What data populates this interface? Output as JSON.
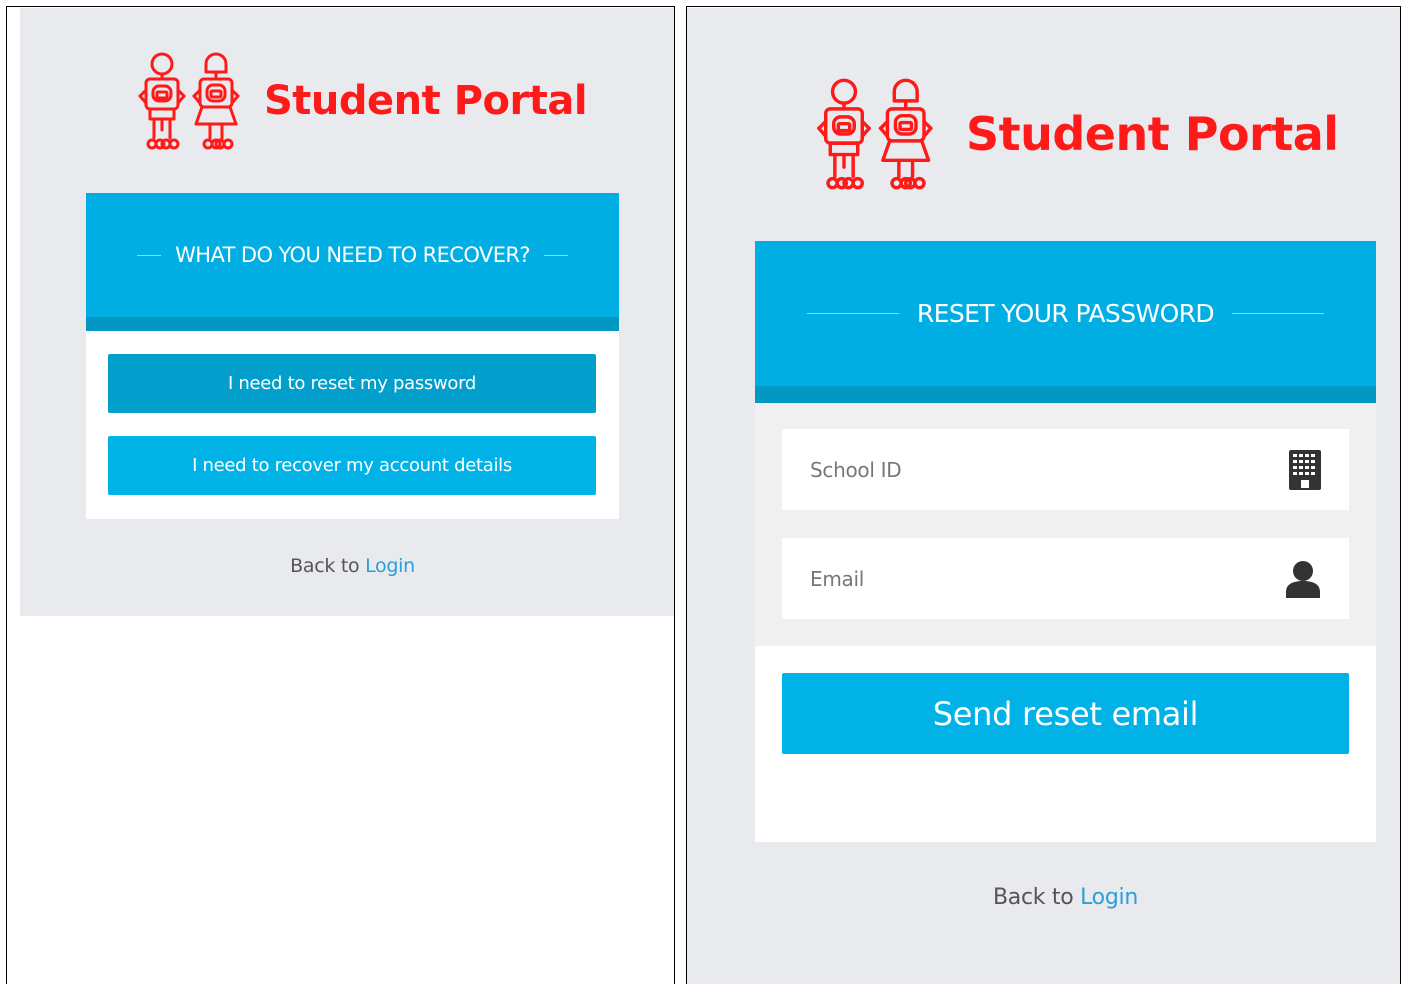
{
  "brand": {
    "title": "Student Portal",
    "logo_color": "#ff1a1a"
  },
  "colors": {
    "accent": "#01aee3",
    "accent_dark": "#0397c4",
    "panel_bg": "#e9eaee",
    "link": "#2b9fd6"
  },
  "recover_panel": {
    "heading": "WHAT DO YOU NEED TO RECOVER?",
    "buttons": {
      "reset_password": "I need to reset my password",
      "recover_account": "I need to recover my account details"
    },
    "back_text": "Back to",
    "back_link": "Login"
  },
  "reset_panel": {
    "heading": "RESET YOUR PASSWORD",
    "fields": {
      "school_id": {
        "placeholder": "School ID",
        "icon": "building-icon"
      },
      "email": {
        "placeholder": "Email",
        "icon": "user-icon"
      }
    },
    "submit_label": "Send reset email",
    "back_text": "Back to",
    "back_link": "Login"
  }
}
